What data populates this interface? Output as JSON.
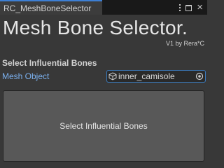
{
  "tab": {
    "title": "RC_MeshBoneSelector",
    "menu_icon": "kebab-menu-icon",
    "maximize_icon": "maximize-icon",
    "close_icon": "close-icon",
    "close_glyph": "×"
  },
  "header": {
    "title": "Mesh Bone Selector.",
    "version": "V1 by Rera*C"
  },
  "section": {
    "header": "Select Influential Bones"
  },
  "mesh_field": {
    "label": "Mesh Object",
    "value": "inner_camisole",
    "type_icon": "mesh-cube-icon",
    "picker_icon": "object-picker-icon"
  },
  "action": {
    "label": "Select Influential Bones"
  },
  "colors": {
    "background": "#383838",
    "tab_accent": "#3d7fd4",
    "label_link": "#7bb0ee",
    "field_border": "#3a79bb",
    "button_bg": "#585858"
  }
}
